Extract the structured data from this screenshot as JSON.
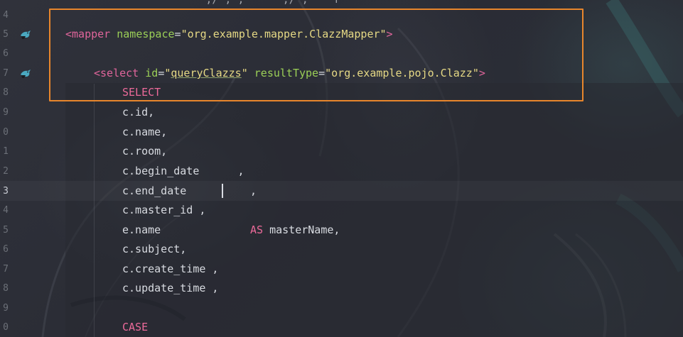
{
  "editor": {
    "top_partial_line": "           ,/ , ,      ,/ ,    r",
    "colors": {
      "highlight_box": "#e8862c",
      "tag": "#e0659b",
      "attribute": "#9bcf57",
      "string": "#e6d985",
      "keyword": "#ec6a9a",
      "text": "#d8dbe1",
      "line_number": "#6c7078"
    },
    "gutter_icons": [
      {
        "line": "5",
        "icon": "mybatis-bird-icon"
      },
      {
        "line": "7",
        "icon": "mybatis-bird-icon"
      }
    ],
    "lines": [
      {
        "num": "4",
        "current": false
      },
      {
        "num": "5",
        "current": false
      },
      {
        "num": "6",
        "current": false
      },
      {
        "num": "7",
        "current": false
      },
      {
        "num": "8",
        "current": false
      },
      {
        "num": "9",
        "current": false
      },
      {
        "num": "0",
        "current": false
      },
      {
        "num": "1",
        "current": false
      },
      {
        "num": "2",
        "current": false
      },
      {
        "num": "3",
        "current": true
      },
      {
        "num": "4",
        "current": false
      },
      {
        "num": "5",
        "current": false
      },
      {
        "num": "6",
        "current": false
      },
      {
        "num": "7",
        "current": false
      },
      {
        "num": "8",
        "current": false
      },
      {
        "num": "9",
        "current": false
      },
      {
        "num": "0",
        "current": false
      }
    ],
    "code": {
      "mapper_open": "<mapper",
      "mapper_ns_attr": "namespace",
      "mapper_eq": "=",
      "mapper_ns_val": "\"org.example.mapper.ClazzMapper\"",
      "mapper_close": ">",
      "select_open": "<select",
      "select_id_attr": "id",
      "select_eq1": "=",
      "select_q1": "\"",
      "select_id_val": "queryClazzs",
      "select_q2": "\"",
      "select_rt_attr": "resultType",
      "select_eq2": "=",
      "select_rt_val": "\"org.example.pojo.Clazz\"",
      "select_close": ">",
      "kw_select": "SELECT",
      "l9": "c.id,",
      "l10": "c.name,",
      "l11": "c.room,",
      "l12": "c.begin_date      ,",
      "l13a": "c.end_date",
      "l13b": ",",
      "l14": "c.master_id ,",
      "l15a": "e.name",
      "l15kw": "AS",
      "l15b": "masterName,",
      "l16": "c.subject,",
      "l17": "c.create_time ,",
      "l18": "c.update_time ,",
      "kw_case": "CASE"
    }
  }
}
